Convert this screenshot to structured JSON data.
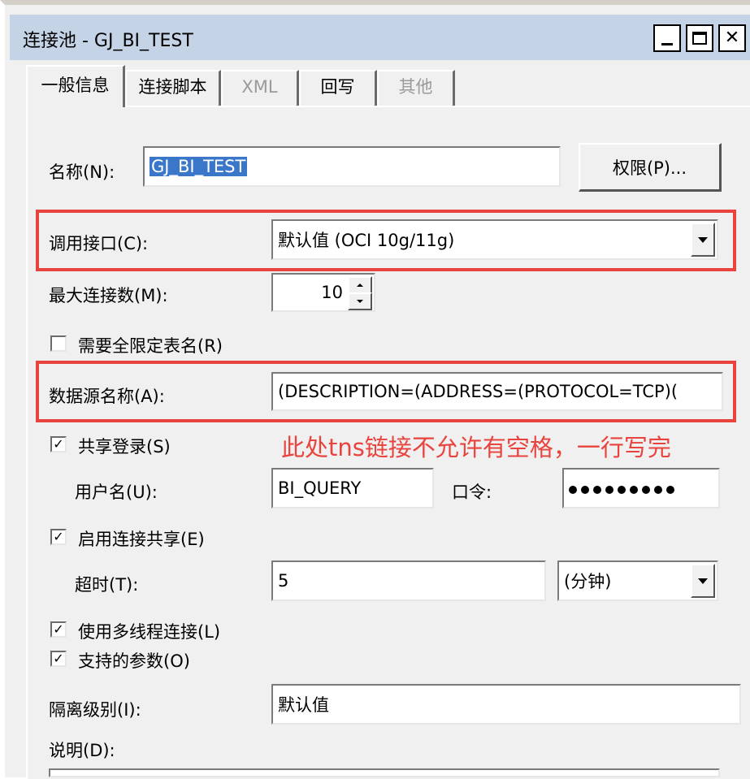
{
  "window": {
    "title": "连接池 - GJ_BI_TEST",
    "minimize_icon": "minimize-icon",
    "maximize_icon": "maximize-icon",
    "close_icon": "close-icon",
    "close_glyph": "✕"
  },
  "tabs": [
    {
      "label": "一般信息",
      "active": true,
      "disabled": false
    },
    {
      "label": "连接脚本",
      "active": false,
      "disabled": false
    },
    {
      "label": "XML",
      "active": false,
      "disabled": true
    },
    {
      "label": "回写",
      "active": false,
      "disabled": false
    },
    {
      "label": "其他",
      "active": false,
      "disabled": true
    }
  ],
  "form": {
    "name_label": "名称(N):",
    "name_value": "GJ_BI_TEST",
    "permissions_button": "权限(P)...",
    "interface_label": "调用接口(C):",
    "interface_value": "默认值 (OCI 10g/11g)",
    "max_conn_label": "最大连接数(M):",
    "max_conn_value": "10",
    "require_qualified_label": "需要全限定表名(R)",
    "require_qualified_checked": false,
    "datasource_label": "数据源名称(A):",
    "datasource_value": "(DESCRIPTION=(ADDRESS=(PROTOCOL=TCP)(",
    "shared_login_label": "共享登录(S)",
    "shared_login_checked": true,
    "username_label": "用户名(U):",
    "username_value": "BI_QUERY",
    "password_label": "口令:",
    "password_length": 9,
    "enable_sharing_label": "启用连接共享(E)",
    "enable_sharing_checked": true,
    "timeout_label": "超时(T):",
    "timeout_value": "5",
    "timeout_unit": "(分钟)",
    "multithread_label": "使用多线程连接(L)",
    "multithread_checked": true,
    "supported_params_label": "支持的参数(O)",
    "supported_params_checked": true,
    "isolation_label": "隔离级别(I):",
    "isolation_value": "默认值",
    "description_label": "说明(D):",
    "check_glyph": "✓"
  },
  "annotation": {
    "text": "此处tns链接不允许有空格，一行写完",
    "color": "#e8433c"
  }
}
